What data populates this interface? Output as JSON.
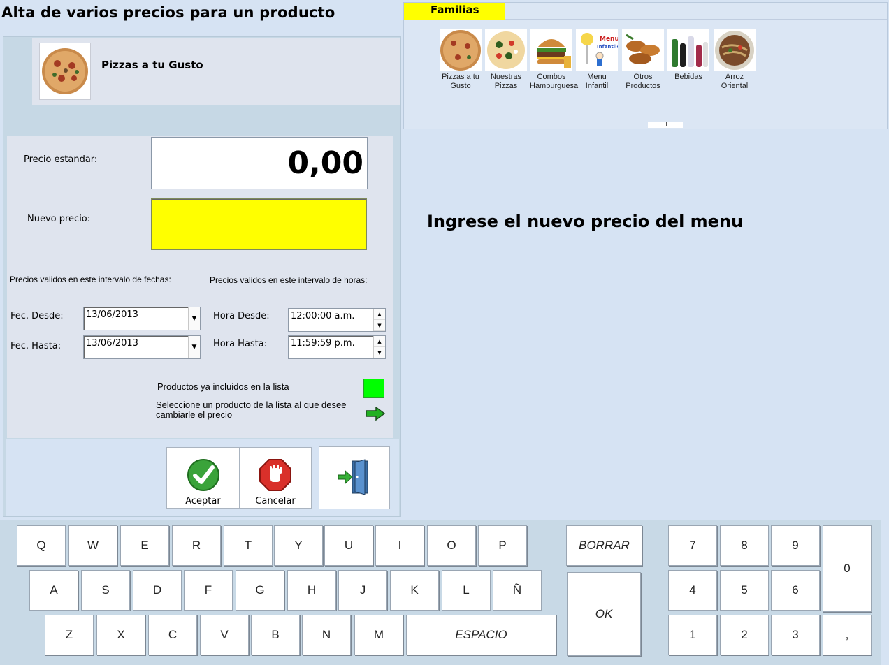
{
  "title": "Alta de varios precios para un producto",
  "product": {
    "name": "Pizzas a tu Gusto",
    "image_icon": "pizza-image"
  },
  "form": {
    "precio_estandar_label": "Precio estandar:",
    "precio_estandar_value": "0,00",
    "nuevo_precio_label": "Nuevo precio:",
    "nuevo_precio_value": "",
    "fechas_caption": "Precios validos en este intervalo de fechas:",
    "horas_caption": "Precios validos en este intervalo de horas:",
    "fec_desde_label": "Fec. Desde:",
    "fec_desde_value": "13/06/2013",
    "fec_hasta_label": "Fec. Hasta:",
    "fec_hasta_value": "13/06/2013",
    "hora_desde_label": "Hora Desde:",
    "hora_desde_value": "12:00:00 a.m.",
    "hora_hasta_label": "Hora Hasta:",
    "hora_hasta_value": "11:59:59 p.m.",
    "legend_included": "Productos ya incluidos en la lista",
    "legend_included_color": "#00ff00",
    "hint_line1": "Seleccione un producto de la lista al que desee",
    "hint_line2": "cambiarle el precio"
  },
  "buttons": {
    "aceptar": "Aceptar",
    "cancelar": "Cancelar",
    "salir_icon": "exit-door-icon"
  },
  "families": {
    "tab_label": "Familias",
    "items": [
      {
        "line1": "Pizzas a tu",
        "line2": "Gusto",
        "icon": "pizza-image"
      },
      {
        "line1": "Nuestras",
        "line2": "Pizzas",
        "icon": "pizza-toppings-image"
      },
      {
        "line1": "Combos",
        "line2": "Hamburguesa",
        "icon": "burger-image"
      },
      {
        "line1": "Menu",
        "line2": "Infantil",
        "icon": "kids-menu-image"
      },
      {
        "line1": "Otros",
        "line2": "Productos",
        "icon": "pastries-image"
      },
      {
        "line1": "Bebidas",
        "line2": "",
        "icon": "drinks-image"
      },
      {
        "line1": "Arroz",
        "line2": "Oriental",
        "icon": "rice-image"
      }
    ]
  },
  "instruction": "Ingrese el nuevo precio del menu",
  "keyboard": {
    "row1": [
      "Q",
      "W",
      "E",
      "R",
      "T",
      "Y",
      "U",
      "I",
      "O",
      "P"
    ],
    "row2": [
      "A",
      "S",
      "D",
      "F",
      "G",
      "H",
      "J",
      "K",
      "L",
      "Ñ"
    ],
    "row3": [
      "Z",
      "X",
      "C",
      "V",
      "B",
      "N",
      "M"
    ],
    "space": "ESPACIO",
    "borrar": "BORRAR",
    "ok": "OK",
    "numpad": [
      "7",
      "8",
      "9",
      "4",
      "5",
      "6",
      "1",
      "2",
      "3"
    ],
    "zero": "0",
    "comma": ","
  },
  "colors": {
    "accent_yellow": "#ffff00",
    "background": "#d6e3f3"
  }
}
